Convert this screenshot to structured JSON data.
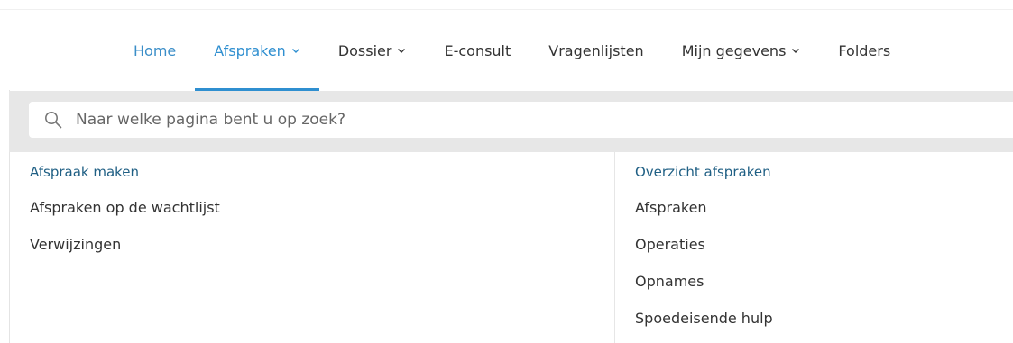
{
  "nav": {
    "items": [
      {
        "label": "Home",
        "has_dropdown": false,
        "active": false
      },
      {
        "label": "Afspraken",
        "has_dropdown": true,
        "active": true
      },
      {
        "label": "Dossier",
        "has_dropdown": true,
        "active": false
      },
      {
        "label": "E-consult",
        "has_dropdown": false,
        "active": false
      },
      {
        "label": "Vragenlijsten",
        "has_dropdown": false,
        "active": false
      },
      {
        "label": "Mijn gegevens",
        "has_dropdown": true,
        "active": false
      },
      {
        "label": "Folders",
        "has_dropdown": false,
        "active": false
      }
    ]
  },
  "search": {
    "placeholder": "Naar welke pagina bent u op zoek?",
    "value": "",
    "icon": "search-icon"
  },
  "menu": {
    "left": {
      "heading": "Afspraak maken",
      "links": [
        "Afspraken op de wachtlijst",
        "Verwijzingen"
      ]
    },
    "right": {
      "heading": "Overzicht afspraken",
      "links": [
        "Afspraken",
        "Operaties",
        "Opnames",
        "Spoedeisende hulp"
      ]
    }
  },
  "colors": {
    "accent": "#2f8fd0",
    "heading": "#1f5f84",
    "search_band": "#e7e7e7",
    "text": "#333333"
  }
}
